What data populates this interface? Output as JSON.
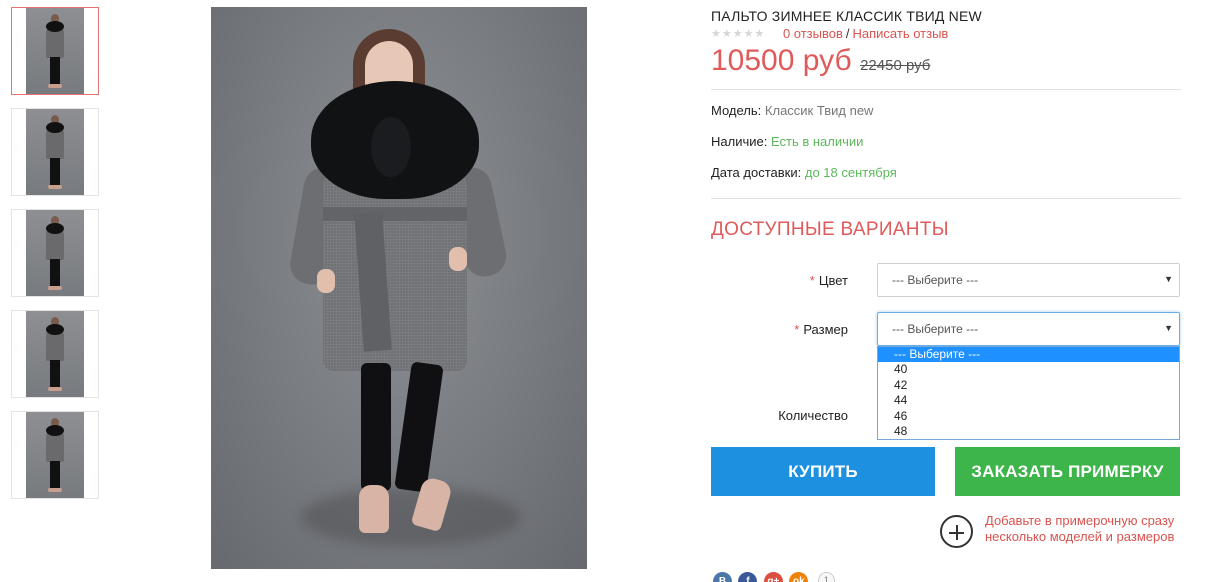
{
  "product": {
    "title": "ПАЛЬТО ЗИМНЕЕ КЛАССИК ТВИД NEW",
    "reviews_link": "0 отзывов",
    "separator": "/",
    "write_review_link": "Написать отзыв",
    "price": "10500 руб",
    "old_price": "22450 руб"
  },
  "attributes": {
    "model_label": "Модель:",
    "model_value": "Классик Твид new",
    "availability_label": "Наличие:",
    "availability_value": "Есть в наличии",
    "delivery_label": "Дата доставки:",
    "delivery_value": "до 18 сентября"
  },
  "variants": {
    "title": "ДОСТУПНЫЕ ВАРИАНТЫ",
    "required_mark": "*",
    "color_label": "Цвет",
    "color_value": "--- Выберите ---",
    "size_label": "Размер",
    "size_value": "--- Выберите ---",
    "size_options": [
      "--- Выберите ---",
      "40",
      "42",
      "44",
      "46",
      "48"
    ],
    "quantity_label": "Количество"
  },
  "buttons": {
    "buy": "КУПИТЬ",
    "fitting": "ЗАКАЗАТЬ ПРИМЕРКУ"
  },
  "fitting_note": "Добавьте в примерочную сразу несколько моделей и размеров",
  "social": {
    "vk": "B",
    "fb": "f",
    "gplus": "g+",
    "ok": "ok",
    "count": "1"
  },
  "colors": {
    "accent_red": "#e05a5a",
    "buy_blue": "#1e90e0",
    "fitting_green": "#3eb54a",
    "in_stock_green": "#5cb85c"
  },
  "icons": {
    "rating": "star-rating-icon",
    "add_to_fitting": "plus-circle-icon",
    "select_arrow": "triangle-down-icon"
  }
}
